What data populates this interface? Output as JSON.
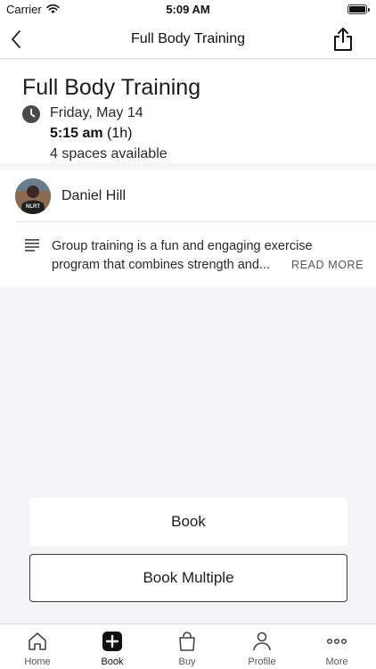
{
  "status": {
    "carrier": "Carrier",
    "time": "5:09 AM"
  },
  "nav": {
    "title": "Full Body Training"
  },
  "event": {
    "title": "Full Body Training",
    "date": "Friday, May 14",
    "time": "5:15 am",
    "duration": "(1h)",
    "spaces": "4 spaces available"
  },
  "instructor": {
    "name": "Daniel Hill",
    "shirt_text": "NLRT"
  },
  "description": {
    "text": "Group training is a fun and engaging exercise program that combines strength and...",
    "read_more": "READ MORE"
  },
  "buttons": {
    "book": "Book",
    "book_multiple": "Book Multiple"
  },
  "tabs": [
    {
      "label": "Home",
      "icon": "home-icon"
    },
    {
      "label": "Book",
      "icon": "plus-square-icon"
    },
    {
      "label": "Buy",
      "icon": "shopping-bag-icon"
    },
    {
      "label": "Profile",
      "icon": "person-icon"
    },
    {
      "label": "More",
      "icon": "ellipsis-icon"
    }
  ],
  "colors": {
    "background": "#f5f5f7",
    "card": "#ffffff",
    "text": "#1c1c1e"
  }
}
